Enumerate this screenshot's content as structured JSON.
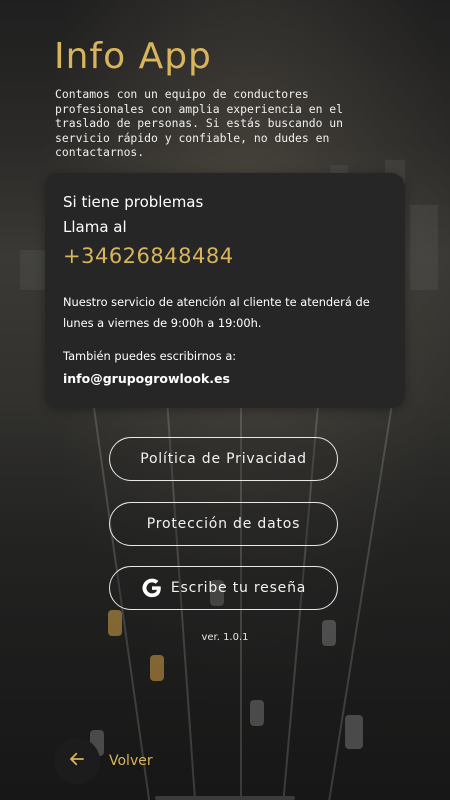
{
  "header": {
    "title": "Info App",
    "intro": "Contamos con un equipo de conductores profesionales con amplia experiencia en el traslado de personas. Si estás buscando un servicio rápido y confiable, no dudes en contactarnos."
  },
  "card": {
    "line1": "Si tiene problemas",
    "line2": "Llama al",
    "phone": "+34626848484",
    "hours": "Nuestro servicio de atención al cliente te atenderá de lunes a viernes de 9:00h a 19:00h.",
    "write_label": "También puedes escribirnos a:",
    "email": "info@grupogrowlook.es"
  },
  "buttons": {
    "privacy": "Política de Privacidad",
    "data_protection": "Protección de datos",
    "review": "Escribe tu reseña",
    "review_icon": "google-g-icon"
  },
  "version": "ver. 1.0.1",
  "footer": {
    "back_label": "Volver",
    "back_icon": "arrow-left-icon"
  },
  "colors": {
    "accent": "#d8b55c",
    "card_bg": "#262626"
  }
}
